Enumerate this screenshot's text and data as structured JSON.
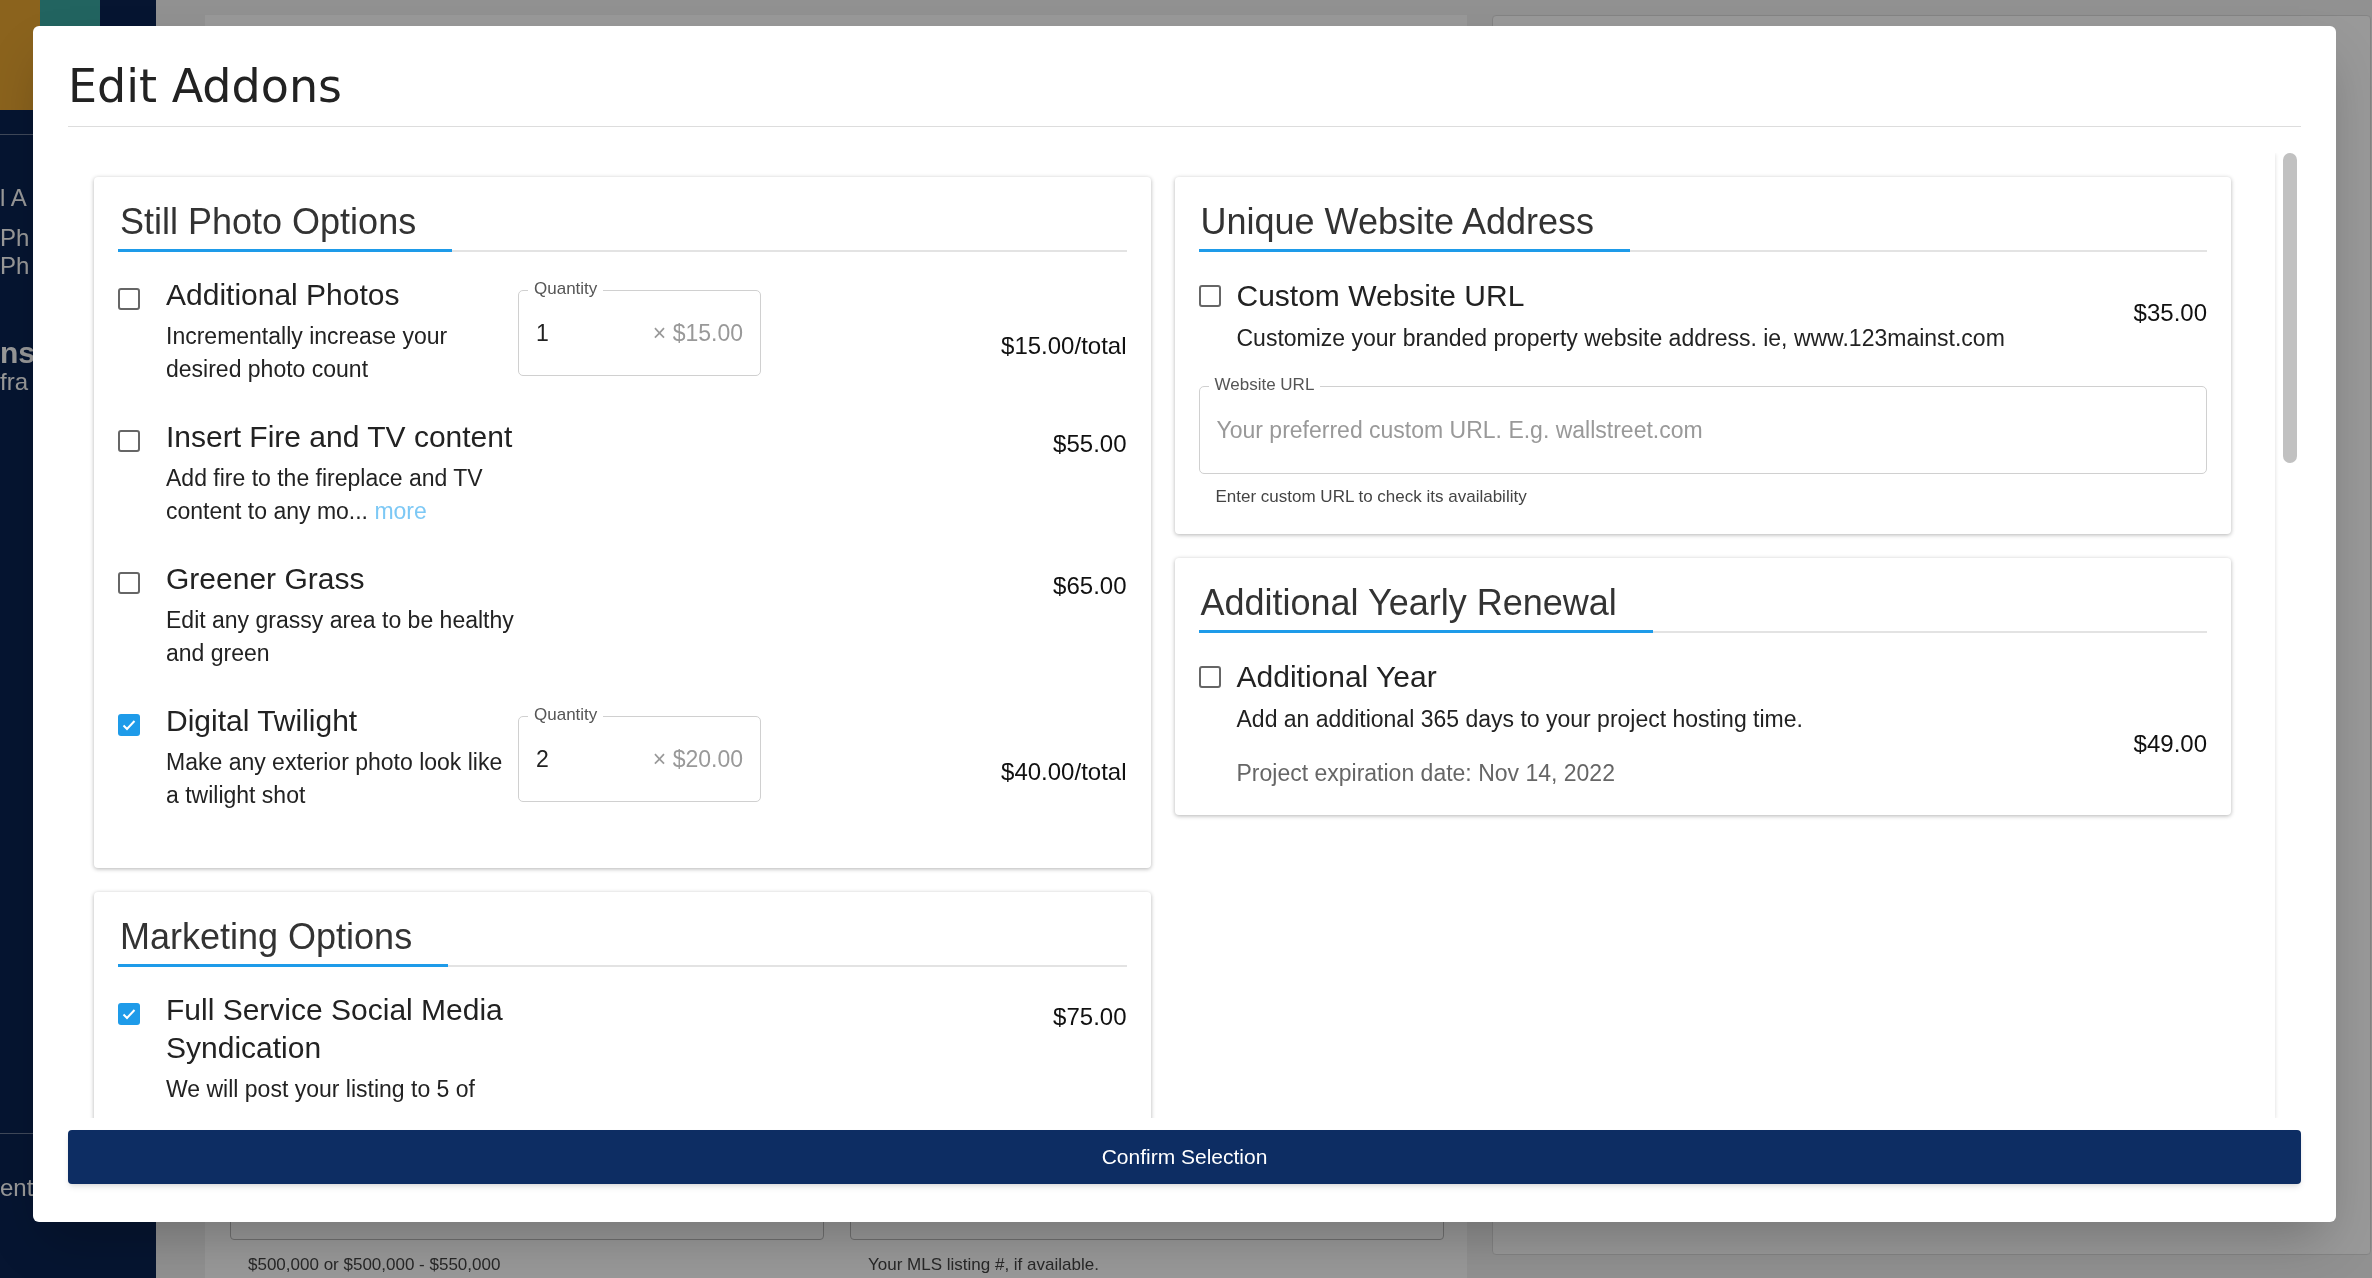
{
  "background": {
    "sidebar_texts": [
      {
        "text": "l A",
        "bold": false
      },
      {
        "text": "Ph",
        "bold": false
      },
      {
        "text": "Ph",
        "bold": false
      },
      {
        "text": "ns",
        "bold": true
      },
      {
        "text": "fra",
        "bold": false
      },
      {
        "text": "ent",
        "bold": false
      }
    ],
    "hints": [
      "$500,000 or $500,000 - $550,000",
      "Your MLS listing #, if available."
    ]
  },
  "dialog": {
    "title": "Edit Addons",
    "columns": [
      [
        {
          "title": "Still Photo Options",
          "items": [
            {
              "kind": "quantity",
              "checked": false,
              "title": "Additional Photos",
              "description": "Incrementally increase your desired photo count",
              "quantity": {
                "label": "Quantity",
                "value": "1",
                "unit_price": "× $15.00"
              },
              "price": "$15.00/total"
            },
            {
              "kind": "simple",
              "checked": false,
              "title": "Insert Fire and TV content",
              "description": "Add fire to the fireplace and TV content to any mo...",
              "more": "more",
              "price": "$55.00"
            },
            {
              "kind": "simple",
              "checked": false,
              "title": "Greener Grass",
              "description": "Edit any grassy area to be healthy and green",
              "price": "$65.00"
            },
            {
              "kind": "quantity",
              "checked": true,
              "title": "Digital Twilight",
              "description": "Make any exterior photo look like a twilight shot",
              "quantity": {
                "label": "Quantity",
                "value": "2",
                "unit_price": "× $20.00"
              },
              "price": "$40.00/total"
            }
          ]
        },
        {
          "title": "Marketing Options",
          "items": [
            {
              "kind": "simple",
              "checked": true,
              "title": "Full Service Social Media Syndication",
              "description": "We will post your listing to 5 of",
              "price": "$75.00"
            }
          ]
        }
      ],
      [
        {
          "title": "Unique Website Address",
          "items": [
            {
              "kind": "wide",
              "checked": false,
              "title": "Custom Website URL",
              "description": "Customize your branded property website address. ie, www.123mainst.com",
              "price": "$35.00",
              "field": {
                "label": "Website URL",
                "placeholder": "Your preferred custom URL. E.g. wallstreet.com",
                "helper": "Enter custom URL to check its availability"
              }
            }
          ]
        },
        {
          "title": "Additional Yearly Renewal",
          "items": [
            {
              "kind": "wide",
              "checked": false,
              "title": "Additional Year",
              "description": "Add an additional 365 days to your project hosting time.",
              "price": "$49.00",
              "note": "Project expiration date: Nov 14, 2022"
            }
          ]
        }
      ]
    ],
    "confirm_button": "Confirm Selection"
  }
}
